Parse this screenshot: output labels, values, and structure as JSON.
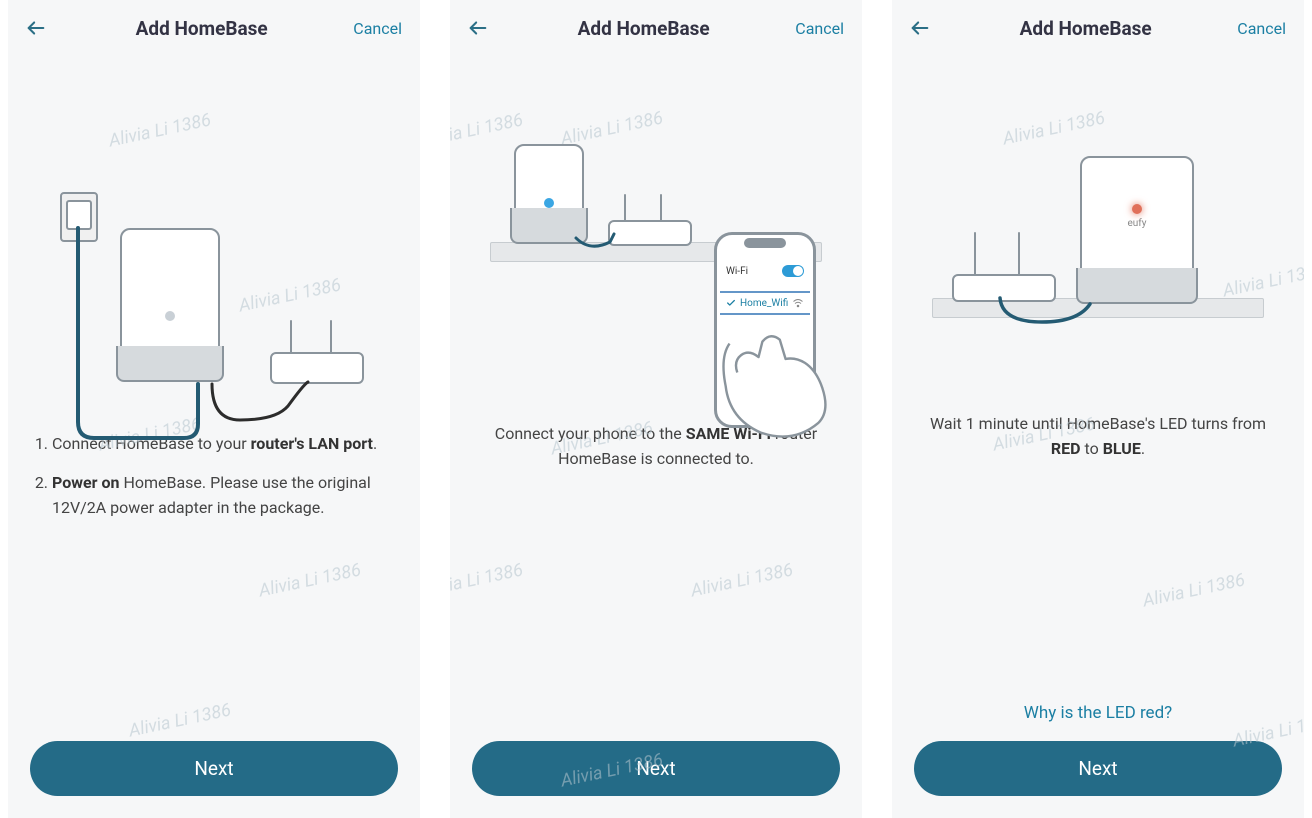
{
  "watermark": "Alivia Li 1386",
  "colors": {
    "accent": "#1b7fa3",
    "button": "#246b87",
    "line": "#245b73",
    "redLed": "#e0705a",
    "blueLed": "#3aa6e3"
  },
  "panels": [
    {
      "title": "Add HomeBase",
      "cancel": "Cancel",
      "next": "Next",
      "steps": {
        "s1_pre": "Connect HomeBase to your ",
        "s1_bold": "router's LAN port",
        "s1_post": ".",
        "s2_bold": "Power on",
        "s2_post": " HomeBase. Please use the original 12V/2A power adapter in the package."
      }
    },
    {
      "title": "Add HomeBase",
      "cancel": "Cancel",
      "next": "Next",
      "wifi": {
        "header": "Wi-Fi",
        "network": "Home_Wifi"
      },
      "text": {
        "pre": "Connect your phone to the ",
        "bold": "SAME Wi-Fi",
        "post": " router HomeBase is connected to."
      }
    },
    {
      "title": "Add HomeBase",
      "cancel": "Cancel",
      "next": "Next",
      "brand": "eufy",
      "text": {
        "pre": "Wait 1 minute until HomeBase's LED turns from ",
        "b1": "RED",
        "mid": " to ",
        "b2": "BLUE",
        "post": "."
      },
      "help": "Why is the LED red?"
    }
  ]
}
